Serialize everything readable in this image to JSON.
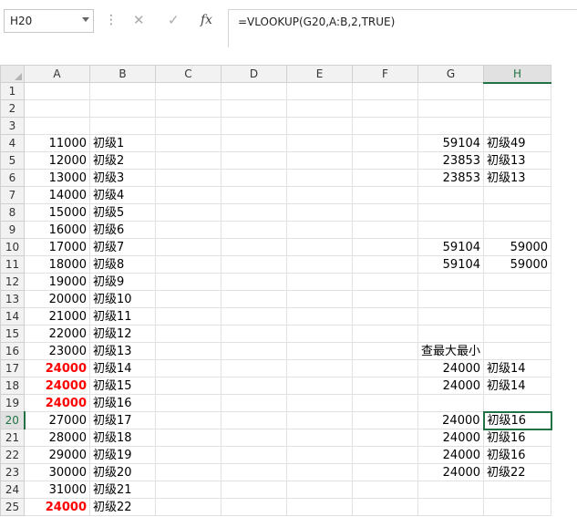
{
  "namebox": "H20",
  "formula": "=VLOOKUP(G20,A:B,2,TRUE)",
  "columns": [
    "A",
    "B",
    "C",
    "D",
    "E",
    "F",
    "G",
    "H"
  ],
  "rows": [
    {
      "n": "1"
    },
    {
      "n": "2"
    },
    {
      "n": "3"
    },
    {
      "n": "4",
      "a": "11000",
      "b": "初级1",
      "g": "59104",
      "h": "初级49"
    },
    {
      "n": "5",
      "a": "12000",
      "b": "初级2",
      "g": "23853",
      "h": "初级13"
    },
    {
      "n": "6",
      "a": "13000",
      "b": "初级3",
      "g": "23853",
      "h": "初级13"
    },
    {
      "n": "7",
      "a": "14000",
      "b": "初级4"
    },
    {
      "n": "8",
      "a": "15000",
      "b": "初级5"
    },
    {
      "n": "9",
      "a": "16000",
      "b": "初级6"
    },
    {
      "n": "10",
      "a": "17000",
      "b": "初级7",
      "g": "59104",
      "h": "59000"
    },
    {
      "n": "11",
      "a": "18000",
      "b": "初级8",
      "g": "59104",
      "h": "59000"
    },
    {
      "n": "12",
      "a": "19000",
      "b": "初级9"
    },
    {
      "n": "13",
      "a": "20000",
      "b": "初级10"
    },
    {
      "n": "14",
      "a": "21000",
      "b": "初级11"
    },
    {
      "n": "15",
      "a": "22000",
      "b": "初级12"
    },
    {
      "n": "16",
      "a": "23000",
      "b": "初级13",
      "g": "查最大最小"
    },
    {
      "n": "17",
      "a": "24000",
      "b": "初级14",
      "g": "24000",
      "h": "初级14"
    },
    {
      "n": "18",
      "a": "24000",
      "b": "初级15",
      "g": "24000",
      "h": "初级14"
    },
    {
      "n": "19",
      "a": "24000",
      "b": "初级16"
    },
    {
      "n": "20",
      "a": "27000",
      "b": "初级17",
      "g": "24000",
      "h": "初级16"
    },
    {
      "n": "21",
      "a": "28000",
      "b": "初级18",
      "g": "24000",
      "h": "初级16"
    },
    {
      "n": "22",
      "a": "29000",
      "b": "初级19",
      "g": "24000",
      "h": "初级16"
    },
    {
      "n": "23",
      "a": "30000",
      "b": "初级20",
      "g": "24000",
      "h": "初级22"
    },
    {
      "n": "24",
      "a": "31000",
      "b": "初级21"
    },
    {
      "n": "25",
      "a": "24000",
      "b": "初级22"
    }
  ],
  "red_rows": [
    "17",
    "18",
    "19",
    "25"
  ],
  "active_cell": {
    "row": "20",
    "col": "H"
  },
  "colors": {
    "accent": "#217346",
    "red": "#ff0000"
  }
}
